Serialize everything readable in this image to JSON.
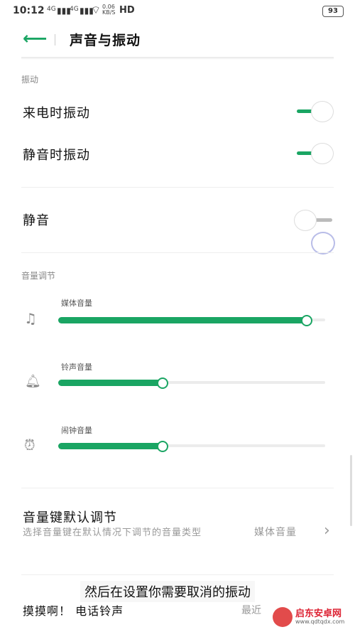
{
  "status_bar": {
    "time": "10:12",
    "signal1": "4G",
    "signal2": "4G",
    "network_speed": "0.06 KB/S",
    "hd": "HD",
    "battery": "93"
  },
  "header": {
    "title": "声音与振动"
  },
  "vibration": {
    "section_label": "振动",
    "ring_vibrate": {
      "label": "来电时振动",
      "on": true
    },
    "silent_vibrate": {
      "label": "静音时振动",
      "on": true
    }
  },
  "mute": {
    "label": "静音",
    "on": false
  },
  "volume": {
    "section_label": "音量调节",
    "media": {
      "label": "媒体音量",
      "level": 0.93
    },
    "ring": {
      "label": "铃声音量",
      "level": 0.39
    },
    "alarm": {
      "label": "闹钟音量",
      "level": 0.39
    }
  },
  "volume_key": {
    "title": "音量键默认调节",
    "description": "选择音量键在默认情况下调节的音量类型",
    "value": "媒体音量"
  },
  "ringtone": {
    "label": "摸摸啊！ 电话铃声",
    "value": "最近"
  },
  "overlay_subtitle": "然后在设置你需要取消的振动",
  "watermark": {
    "text": "启东安卓网",
    "url": "www.qdtqdx.com"
  }
}
